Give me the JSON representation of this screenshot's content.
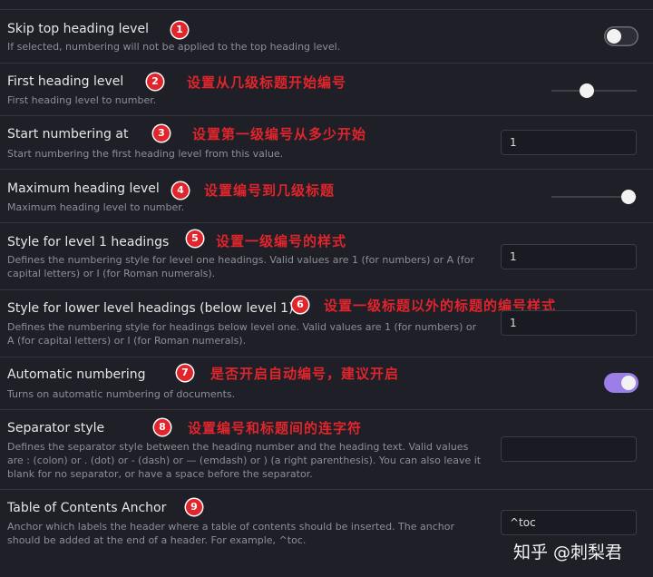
{
  "settings": [
    {
      "title": "Skip top heading level",
      "desc": "If selected, numbering will not be applied to the top heading level.",
      "badge": "1",
      "note": "",
      "control": "toggle",
      "on": false
    },
    {
      "title": "First heading level",
      "desc": "First heading level to number.",
      "badge": "2",
      "note": "设置从几级标题开始编号",
      "control": "slider",
      "slider_level": 0.42
    },
    {
      "title": "Start numbering at",
      "desc": "Start numbering the first heading level from this value.",
      "badge": "3",
      "note": "设置第一级编号从多少开始",
      "control": "input",
      "value": "1"
    },
    {
      "title": "Maximum heading level",
      "desc": "Maximum heading level to number.",
      "badge": "4",
      "note": "设置编号到几级标题",
      "control": "slider",
      "slider_level": 0.9
    },
    {
      "title": "Style for level 1 headings",
      "desc": "Defines the numbering style for level one headings. Valid values are 1 (for numbers) or A (for capital letters) or I (for Roman numerals).",
      "badge": "5",
      "note": "设置一级编号的样式",
      "control": "input",
      "value": "1"
    },
    {
      "title": "Style for lower level headings (below level 1)",
      "desc": "Defines the numbering style for headings below level one. Valid values are 1 (for numbers) or A (for capital letters) or I (for Roman numerals).",
      "badge": "6",
      "note": "设置一级标题以外的标题的编号样式",
      "control": "input",
      "value": "1"
    },
    {
      "title": "Automatic numbering",
      "desc": "Turns on automatic numbering of documents.",
      "badge": "7",
      "note": "是否开启自动编号，建议开启",
      "control": "toggle",
      "on": true
    },
    {
      "title": "Separator style",
      "desc": "Defines the separator style between the heading number and the heading text. Valid values are : (colon) or . (dot) or - (dash) or — (emdash) or ) (a right parenthesis). You can also leave it blank for no separator, or have a space before the separator.",
      "badge": "8",
      "note": "设置编号和标题间的连字符",
      "control": "input",
      "value": ""
    },
    {
      "title": "Table of Contents Anchor",
      "desc": "Anchor which labels the header where a table of contents should be inserted. The anchor should be added at the end of a header. For example, ^toc.",
      "badge": "9",
      "note": "",
      "control": "input",
      "value": "^toc"
    }
  ],
  "watermark": "知乎 @刺梨君",
  "colors": {
    "background": "#1e1f27",
    "accent": "#9b7ee6",
    "annotation": "#e0252c"
  }
}
